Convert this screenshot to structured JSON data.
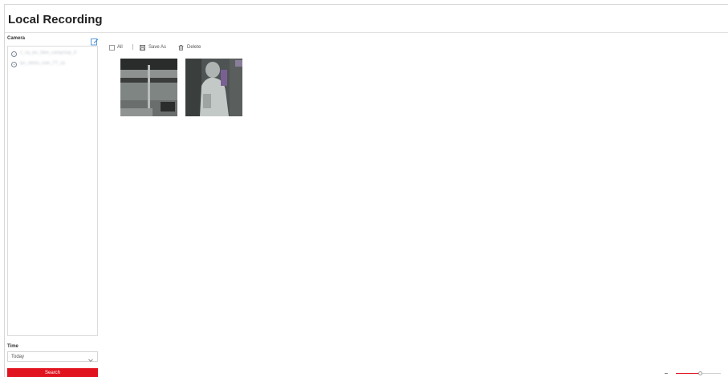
{
  "window": {
    "title": "Local Recording"
  },
  "sidebar": {
    "camera_label": "Camera",
    "cameras": [
      {
        "name": "1_cq_ipc_fake_camgroup_4"
      },
      {
        "name": "ipc_demo_cam_TT_cp"
      }
    ],
    "time_label": "Time",
    "time_value": "Today",
    "search_label": "Search"
  },
  "toolbar": {
    "all_label": "All",
    "save_as_label": "Save As",
    "delete_label": "Delete"
  },
  "recordings": [
    {
      "kind": "corridor"
    },
    {
      "kind": "person"
    }
  ],
  "zoom": {
    "level": 0.55
  },
  "colors": {
    "accent": "#e0131f",
    "border": "#dcdcdc"
  }
}
